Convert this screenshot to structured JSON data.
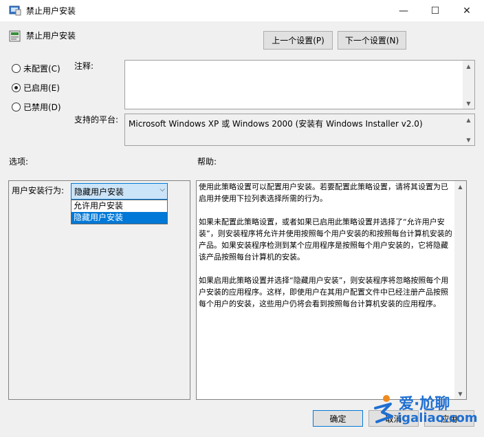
{
  "window": {
    "title": "禁止用户安装",
    "min_glyph": "—",
    "max_glyph": "☐",
    "close_glyph": "✕"
  },
  "header": {
    "title": "禁止用户安装",
    "prev_label": "上一个设置(P)",
    "next_label": "下一个设置(N)"
  },
  "state": {
    "options": [
      {
        "label": "未配置(C)",
        "checked": false
      },
      {
        "label": "已启用(E)",
        "checked": true
      },
      {
        "label": "已禁用(D)",
        "checked": false
      }
    ]
  },
  "comment": {
    "label": "注释:",
    "value": ""
  },
  "platform": {
    "label": "支持的平台:",
    "value": "Microsoft Windows XP 或 Windows 2000 (安装有 Windows Installer v2.0)"
  },
  "options_panel": {
    "label": "选项:",
    "behavior_label": "用户安装行为:",
    "selected": "隐藏用户安装",
    "dropdown_items": [
      "允许用户安装",
      "隐藏用户安装"
    ]
  },
  "help": {
    "label": "帮助:",
    "paragraphs": [
      "使用此策略设置可以配置用户安装。若要配置此策略设置，请将其设置为已启用并使用下拉列表选择所需的行为。",
      "如果未配置此策略设置，或者如果已启用此策略设置并选择了“允许用户安装”，则安装程序将允许并使用按照每个用户安装的和按照每台计算机安装的产品。如果安装程序检测到某个应用程序是按照每个用户安装的，它将隐藏该产品按照每台计算机的安装。",
      "如果启用此策略设置并选择“隐藏用户安装”，则安装程序将忽略按照每个用户安装的应用程序。这样，即使用户在其用户配置文件中已经注册产品按照每个用户的安装，这些用户仍将会看到按照每台计算机安装的应用程序。"
    ]
  },
  "footer": {
    "ok_label": "确定",
    "cancel_label": "取消",
    "apply_label": "应用"
  },
  "watermark": {
    "cn": "爱·尬聊",
    "url": "igaliao.com"
  },
  "colors": {
    "accent": "#0078d7",
    "watermark": "#1f6fd1"
  }
}
